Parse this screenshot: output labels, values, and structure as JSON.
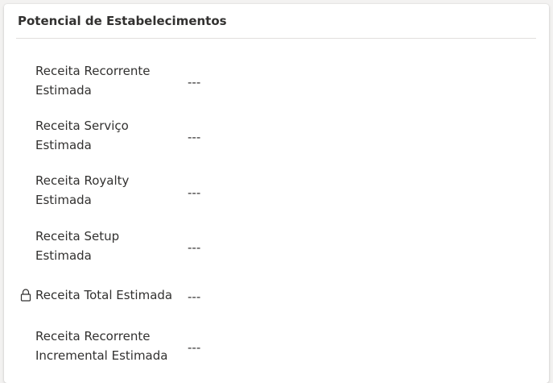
{
  "section": {
    "title": "Potencial de Estabelecimentos"
  },
  "fields": [
    {
      "label": "Receita Recorrente Estimada",
      "value": "---",
      "locked": false
    },
    {
      "label": "Receita Serviço Estimada",
      "value": "---",
      "locked": false
    },
    {
      "label": "Receita Royalty Estimada",
      "value": "---",
      "locked": false
    },
    {
      "label": "Receita Setup Estimada",
      "value": "---",
      "locked": false
    },
    {
      "label": "Receita Total Estimada",
      "value": "---",
      "locked": true,
      "icon": "lock-icon"
    },
    {
      "label": "Receita Recorrente Incremental Estimada",
      "value": "---",
      "locked": false
    }
  ]
}
